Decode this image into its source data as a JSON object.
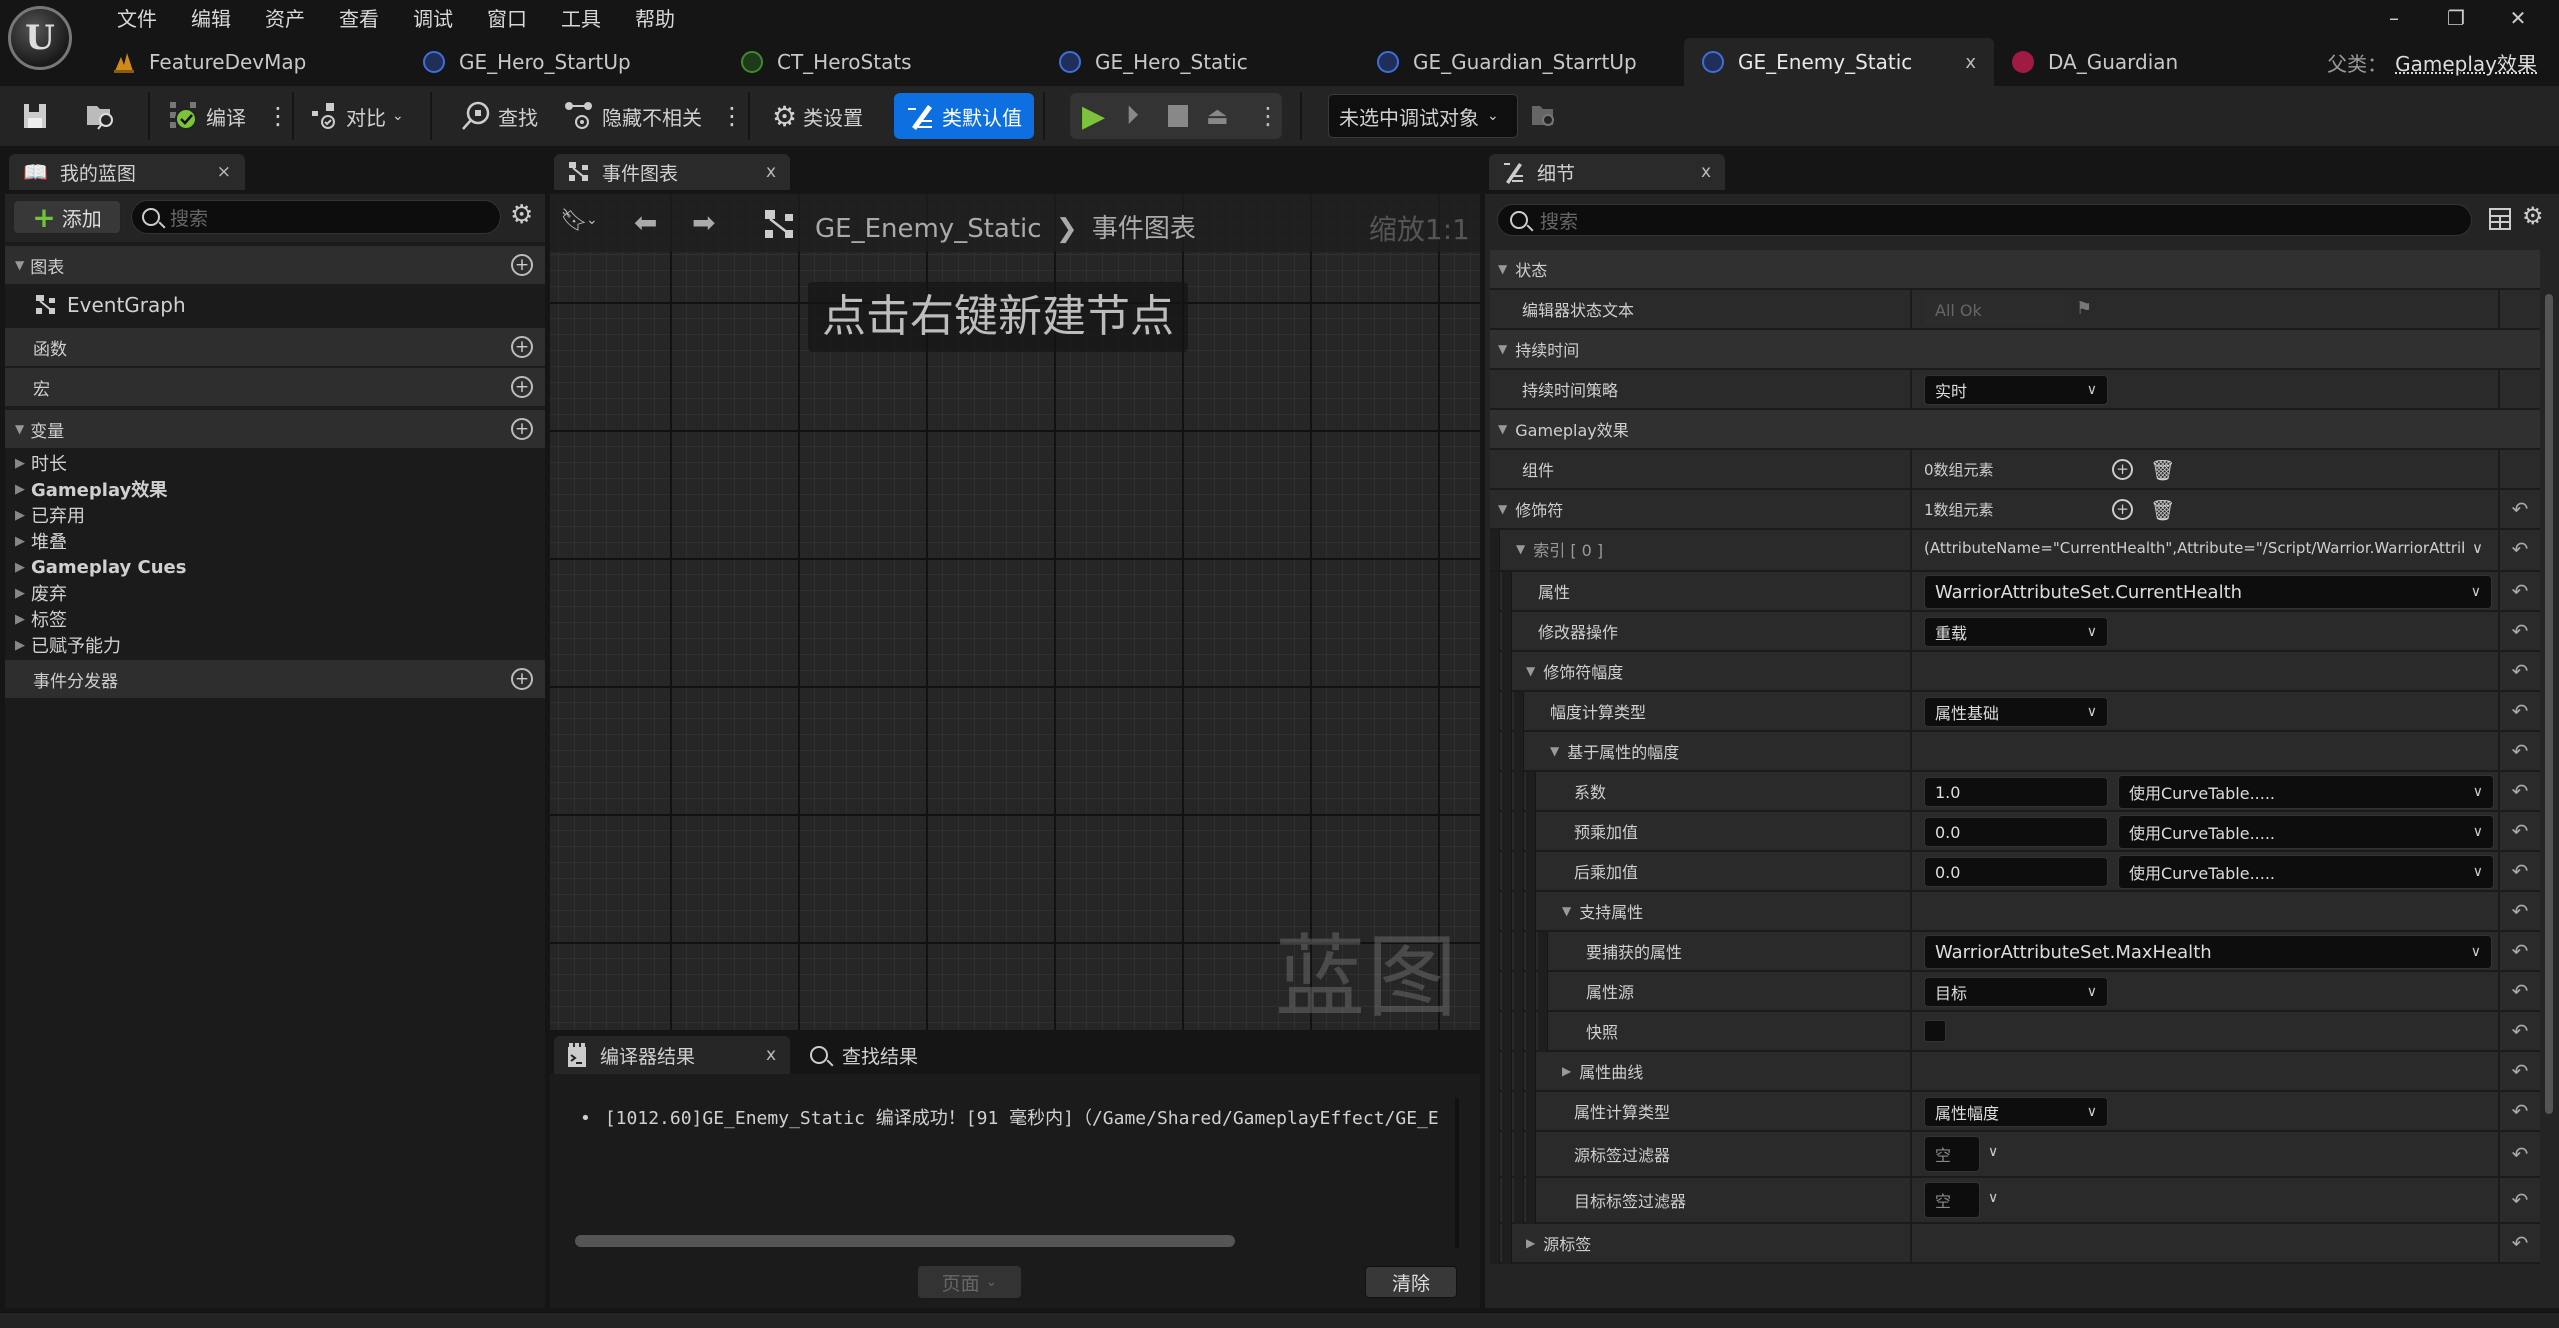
{
  "menu": [
    "文件",
    "编辑",
    "资产",
    "查看",
    "调试",
    "窗口",
    "工具",
    "帮助"
  ],
  "window_controls": {
    "minimize": "–",
    "restore": "❐",
    "close": "✕"
  },
  "tabs": [
    {
      "label": "FeatureDevMap",
      "icon": "map-icon",
      "color": "#d08a1a"
    },
    {
      "label": "GE_Hero_StartUp",
      "icon": "gameplay-effect-icon",
      "color": "#3f6fd6"
    },
    {
      "label": "CT_HeroStats",
      "icon": "curve-table-icon",
      "color": "#3d8a2d"
    },
    {
      "label": "GE_Hero_Static",
      "icon": "gameplay-effect-icon",
      "color": "#3f6fd6"
    },
    {
      "label": "GE_Guardian_StarrtUp",
      "icon": "gameplay-effect-icon",
      "color": "#3f6fd6"
    },
    {
      "label": "GE_Enemy_Static",
      "icon": "gameplay-effect-icon",
      "color": "#3f6fd6",
      "active": true,
      "close": "x"
    },
    {
      "label": "DA_Guardian",
      "icon": "data-asset-icon",
      "color": "#a01a44"
    }
  ],
  "parent_class": {
    "label": "父类：",
    "value": "Gameplay效果"
  },
  "toolbar": {
    "compile": "编译",
    "diff": "对比",
    "find": "查找",
    "hide_unrelated": "隐藏不相关",
    "class_settings": "类设置",
    "class_defaults": "类默认值",
    "debug_target": "未选中调试对象",
    "accent": "#0e6fe0",
    "play_color": "#7cc23a"
  },
  "my_blueprint": {
    "tab": "我的蓝图",
    "close": "×",
    "add": "添加",
    "search_placeholder": "搜索",
    "sections": {
      "graphs": "图表",
      "event_graph": "EventGraph",
      "functions": "函数",
      "macros": "宏",
      "variables": "变量",
      "dispatchers": "事件分发器"
    },
    "variable_categories": [
      {
        "label": "时长",
        "bold": false
      },
      {
        "label": "Gameplay效果",
        "bold": true
      },
      {
        "label": "已弃用",
        "bold": false
      },
      {
        "label": "堆叠",
        "bold": false
      },
      {
        "label": "Gameplay Cues",
        "bold": true
      },
      {
        "label": "废弃",
        "bold": false
      },
      {
        "label": "标签",
        "bold": false
      },
      {
        "label": "已赋予能力",
        "bold": false
      }
    ]
  },
  "graph": {
    "tab": "事件图表",
    "close": "x",
    "breadcrumb_root": "GE_Enemy_Static",
    "breadcrumb_sep": "❯",
    "breadcrumb_leaf": "事件图表",
    "zoom": "缩放1:1",
    "hint": "点击右键新建节点",
    "watermark": "蓝图"
  },
  "compiler": {
    "tab": "编译器结果",
    "close": "x",
    "find_tab": "查找结果",
    "log": "[1012.60]GE_Enemy_Static 编译成功！[91 毫秒内]（/Game/Shared/GameplayEffect/GE_E",
    "page": "页面",
    "clear": "清除"
  },
  "details": {
    "tab": "细节",
    "close": "x",
    "search_placeholder": "搜索",
    "rows": [
      {
        "label": "状态",
        "type": "category"
      },
      {
        "label": "编辑器状态文本",
        "value": "All Ok"
      },
      {
        "label": "持续时间",
        "type": "category"
      },
      {
        "label": "持续时间策略",
        "value": "实时"
      },
      {
        "label": "Gameplay效果",
        "type": "category"
      },
      {
        "label": "组件",
        "value": "0数组元素"
      },
      {
        "label": "修饰符",
        "value": "1数组元素"
      },
      {
        "label": "索引 [ 0 ]",
        "value": "(AttributeName=\"CurrentHealth\",Attribute=\"/Script/Warrior.WarriorAttrib"
      },
      {
        "label": "属性",
        "value": "WarriorAttributeSet.CurrentHealth"
      },
      {
        "label": "修改器操作",
        "value": "重载"
      },
      {
        "label": "修饰符幅度"
      },
      {
        "label": "幅度计算类型",
        "value": "属性基础"
      },
      {
        "label": "基于属性的幅度"
      },
      {
        "label": "系数",
        "value": "1.0",
        "curve": "使用CurveTable....."
      },
      {
        "label": "预乘加值",
        "value": "0.0",
        "curve": "使用CurveTable....."
      },
      {
        "label": "后乘加值",
        "value": "0.0",
        "curve": "使用CurveTable....."
      },
      {
        "label": "支持属性"
      },
      {
        "label": "要捕获的属性",
        "value": "WarriorAttributeSet.MaxHealth"
      },
      {
        "label": "属性源",
        "value": "目标"
      },
      {
        "label": "快照",
        "checked": false
      },
      {
        "label": "属性曲线"
      },
      {
        "label": "属性计算类型",
        "value": "属性幅度"
      },
      {
        "label": "源标签过滤器",
        "value": "空"
      },
      {
        "label": "目标标签过滤器",
        "value": "空"
      },
      {
        "label": "源标签"
      }
    ]
  }
}
